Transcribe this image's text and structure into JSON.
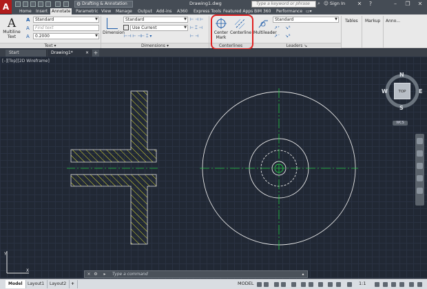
{
  "titlebar": {
    "logo": "A",
    "workspace": "Drafting & Annotation",
    "document_title": "Drawing1.dwg",
    "search_placeholder": "Type a keyword or phrase",
    "signin": "Sign In"
  },
  "ribbon_tabs": [
    {
      "label": "Home"
    },
    {
      "label": "Insert"
    },
    {
      "label": "Annotate"
    },
    {
      "label": "Parametric"
    },
    {
      "label": "View"
    },
    {
      "label": "Manage"
    },
    {
      "label": "Output"
    },
    {
      "label": "Add-ins"
    },
    {
      "label": "A360"
    },
    {
      "label": "Express Tools"
    },
    {
      "label": "Featured Apps"
    },
    {
      "label": "BIM 360"
    },
    {
      "label": "Performance"
    }
  ],
  "active_tab": "Annotate",
  "ribbon": {
    "text_panel": {
      "title": "Text",
      "multiline_text": "Multiline Text",
      "style": "Standard",
      "find_placeholder": "Find text",
      "height": "0.2000"
    },
    "dimensions_panel": {
      "title": "Dimensions",
      "dimension_button": "Dimension",
      "style": "Standard",
      "layer": "Use Current"
    },
    "centerlines_panel": {
      "title": "Centerlines",
      "center_mark": "Center Mark",
      "centerline": "Centerline"
    },
    "leaders_panel": {
      "title": "Leaders",
      "multileader": "Multileader",
      "style": "Standard"
    },
    "tables_panel": {
      "title": "Tables"
    },
    "markup_panel": {
      "title": "Markup"
    },
    "annotation_panel": {
      "title": "Anno..."
    }
  },
  "file_tabs": {
    "start": "Start",
    "drawing": "Drawing1*"
  },
  "viewport": {
    "label": "[–][Top][2D Wireframe]",
    "viewcube": {
      "face": "TOP",
      "n": "N",
      "s": "S",
      "e": "E",
      "w": "W",
      "wcs": "WCS"
    }
  },
  "command_line": {
    "placeholder": "Type a command"
  },
  "layouts": [
    {
      "label": "Model"
    },
    {
      "label": "Layout1"
    },
    {
      "label": "Layout2"
    }
  ],
  "status": {
    "model": "MODEL",
    "scale": "1:1"
  },
  "colors": {
    "hatch": "#e6e633",
    "centerline": "#22cc44",
    "geometry": "#e8e8e8",
    "highlight": "#e02020"
  }
}
